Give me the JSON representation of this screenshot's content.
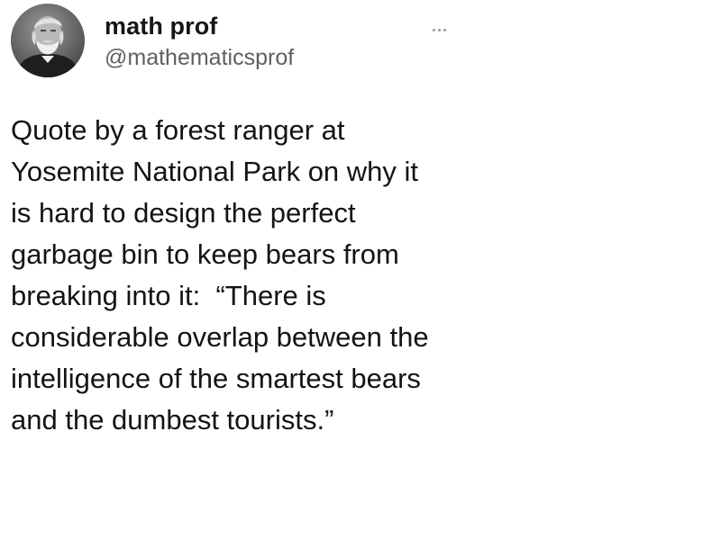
{
  "author": {
    "display_name": "math prof",
    "handle": "@mathematicsprof",
    "avatar_icon": "bearded-man-portrait-icon"
  },
  "menu": {
    "more_icon": "more-options-ellipsis-icon"
  },
  "tweet": {
    "lines": [
      "Quote by a forest ranger at",
      "Yosemite National Park on why it",
      "is hard to design the perfect",
      "garbage bin to keep bears from",
      "breaking into it:  “There is",
      "considerable overlap between the",
      "intelligence of the smartest bears",
      "and the dumbest tourists.”"
    ]
  }
}
